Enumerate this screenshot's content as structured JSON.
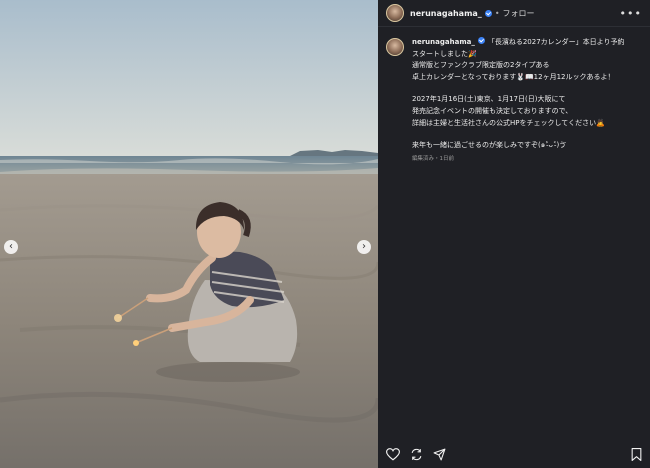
{
  "post": {
    "username": "nerunagahama_",
    "separator": "•",
    "follow_label": "フォロー",
    "more_label": "•••",
    "caption_lines": [
      "「長濱ねる2027カレンダー」本日より予約",
      "スタートしました🎉",
      "通常版とファンクラブ限定版の2タイプある",
      "卓上カレンダーとなっております🐰📖12ヶ月12ルックあるよ！"
    ],
    "caption_lines_2": [
      "2027年1月16日(土)東京、1月17日(日)大阪にて",
      "発売記念イベントの開催も決定しておりますので、",
      "詳細は主婦と生活社さんの公式HPをチェックしてください🙇"
    ],
    "caption_lines_3": [
      "来年も一緒に過ごせるのが楽しみですぞ(๑˃̵ᴗ˂̵)ゔ"
    ],
    "meta": "編集済み・1日前"
  },
  "icons": {
    "verified": "verified-badge-icon",
    "prev": "chevron-left-icon",
    "next": "chevron-right-icon",
    "like": "heart-icon",
    "repost": "repost-icon",
    "share": "send-icon",
    "save": "bookmark-icon"
  },
  "nav": {
    "prev_glyph": "‹",
    "next_glyph": "›"
  },
  "colors": {
    "panel_bg": "#1f2025",
    "verified": "#3b82f6"
  }
}
